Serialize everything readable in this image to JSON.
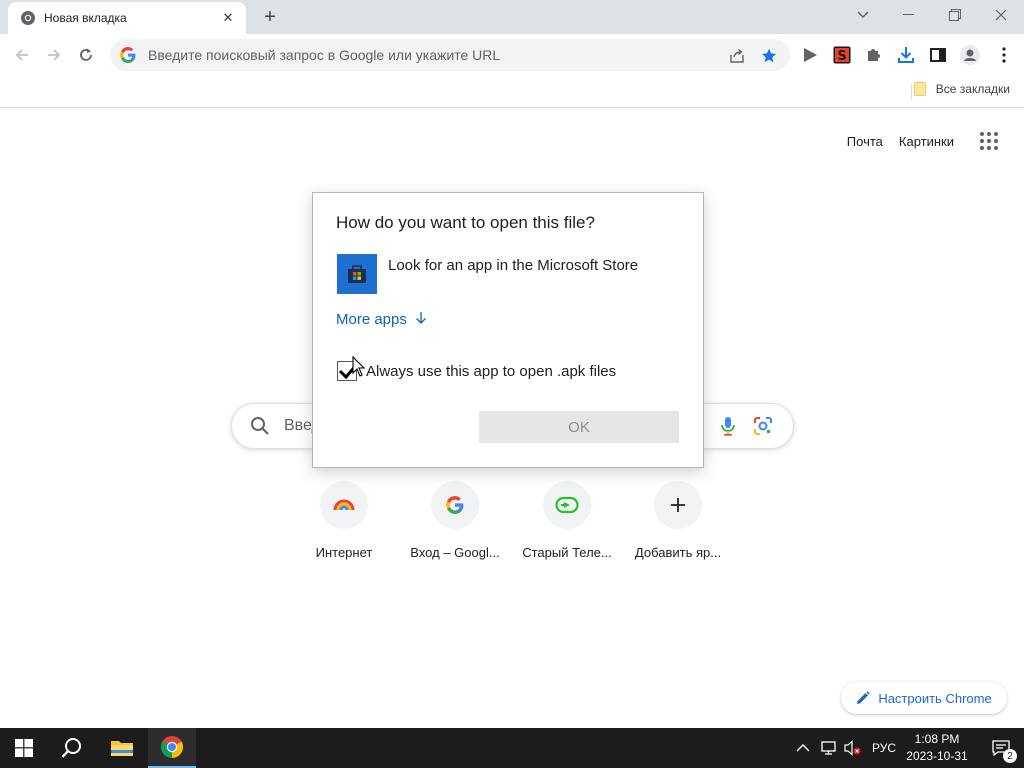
{
  "browser": {
    "tab": {
      "title": "Новая вкладка"
    },
    "omnibox": {
      "placeholder": "Введите поисковый запрос в Google или укажите URL"
    },
    "bookmarks": {
      "all_label": "Все закладки"
    }
  },
  "ntp": {
    "links": {
      "mail": "Почта",
      "images": "Картинки"
    },
    "search_placeholder": "Введ",
    "shortcuts": [
      {
        "label": "Интернет",
        "icon": "rainbow-arc-icon"
      },
      {
        "label": "Вход – Googl...",
        "icon": "google-g-icon"
      },
      {
        "label": "Старый Теле...",
        "icon": "tv-icon"
      },
      {
        "label": "Добавить яр...",
        "icon": "plus-icon"
      }
    ],
    "customize_label": "Настроить Chrome"
  },
  "dialog": {
    "title": "How do you want to open this file?",
    "app_label": "Look for an app in the Microsoft Store",
    "more_apps": "More apps",
    "always_use_label": "Always use this app to open .apk files",
    "always_use_checked": true,
    "ok_label": "OK"
  },
  "taskbar": {
    "language": "РУС",
    "time": "1:08 PM",
    "date": "2023-10-31",
    "notification_count": "2"
  },
  "colors": {
    "accent_blue": "#1a73e8",
    "link_blue": "#0a66b2",
    "taskbar_bg": "#1c1c1c"
  }
}
